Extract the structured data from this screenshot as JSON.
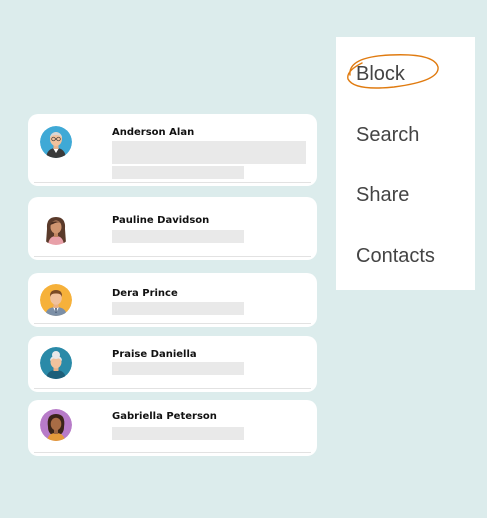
{
  "contacts": [
    {
      "name": "Anderson Alan",
      "avatar_icon": "man-bald-glasses-avatar-icon"
    },
    {
      "name": "Pauline Davidson",
      "avatar_icon": "woman-brown-hair-avatar-icon"
    },
    {
      "name": "Dera Prince",
      "avatar_icon": "man-suit-avatar-icon"
    },
    {
      "name": "Praise Daniella",
      "avatar_icon": "woman-white-hair-avatar-icon"
    },
    {
      "name": "Gabriella Peterson",
      "avatar_icon": "woman-dark-hair-avatar-icon"
    }
  ],
  "menu": {
    "items": [
      {
        "label": "Block",
        "highlighted": true
      },
      {
        "label": "Search"
      },
      {
        "label": "Share"
      },
      {
        "label": "Contacts"
      }
    ],
    "highlight_color": "#e07b10"
  },
  "colors": {
    "background": "#dcecec",
    "card": "#ffffff",
    "placeholder": "#e9e9e9"
  }
}
